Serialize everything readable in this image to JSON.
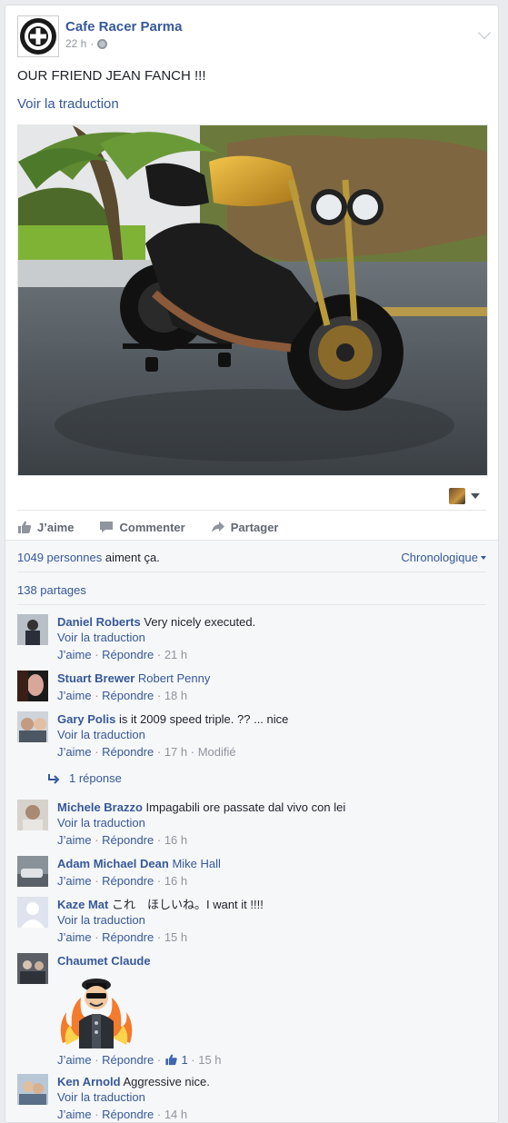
{
  "post": {
    "page_name": "Cafe Racer Parma",
    "time": "22 h",
    "separator": "·",
    "text": "OUR FRIEND JEAN FANCH !!!",
    "translate": "Voir la traduction"
  },
  "actions": {
    "like": "J’aime",
    "comment": "Commenter",
    "share": "Partager"
  },
  "feedback": {
    "likes_count": "1049 personnes",
    "likes_suffix": " aiment ça.",
    "order": "Chronologique",
    "shares": "138 partages"
  },
  "comment_labels": {
    "like": "J’aime",
    "reply": "Répondre",
    "translate": "Voir la traduction",
    "edited": "Modifié",
    "replies": "1 réponse"
  },
  "comments": [
    {
      "author": "Daniel Roberts",
      "text": "Very nicely executed.",
      "time": "21 h"
    },
    {
      "author": "Stuart Brewer",
      "text": "Robert Penny",
      "time": "18 h"
    },
    {
      "author": "Gary Polis",
      "text": "is it 2009 speed triple. ?? ... nice",
      "time": "17 h"
    },
    {
      "author": "Michele Brazzo",
      "text": "Impagabili ore passate dal vivo con lei",
      "time": "16 h"
    },
    {
      "author": "Adam Michael Dean",
      "text": "Mike Hall",
      "time": "16 h"
    },
    {
      "author": "Kaze Mat",
      "text": "これ　ほしいね。I want it !!!!",
      "time": "15 h"
    },
    {
      "author": "Chaumet Claude",
      "text": "",
      "time": "15 h",
      "likes": "1"
    },
    {
      "author": "Ken Arnold",
      "text": "Aggressive nice.",
      "time": "14 h"
    }
  ],
  "colors": {
    "link": "#365899",
    "meta": "#90949c",
    "feedback_bg": "#f6f7f9"
  }
}
